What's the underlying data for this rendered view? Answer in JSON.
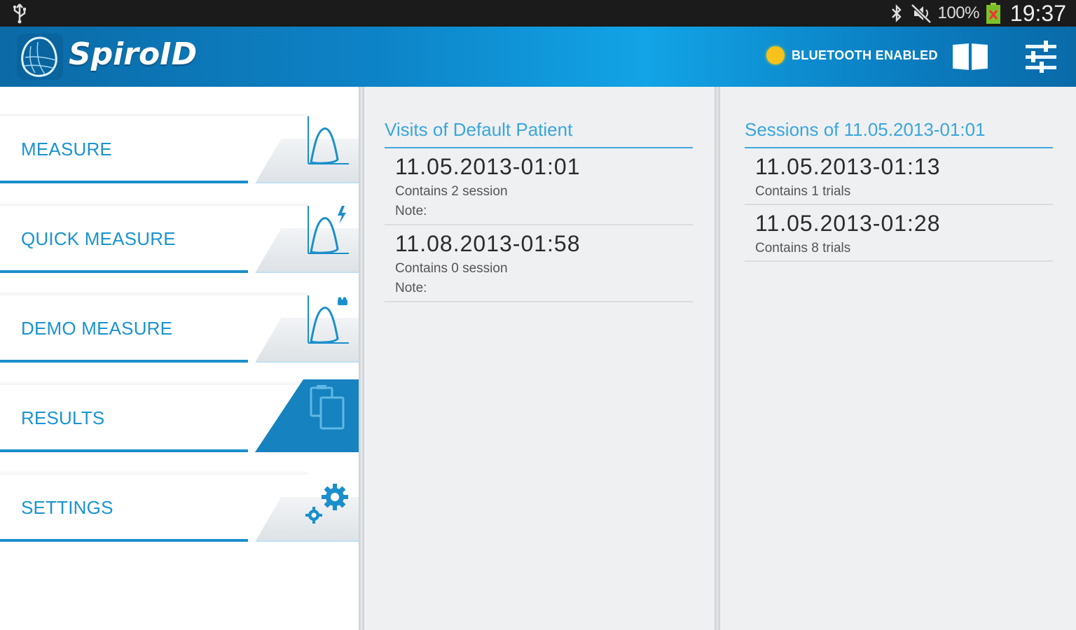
{
  "status_bar": {
    "battery_percent": "100%",
    "time": "19:37",
    "icons": [
      "usb-icon",
      "bluetooth-icon",
      "mute-icon",
      "battery-icon"
    ]
  },
  "app_bar": {
    "app_name": "SpiroID",
    "bluetooth_status": "BLUETOOTH ENABLED",
    "status_color": "#f7c21b",
    "accent_color": "#1a93d0"
  },
  "sidebar": {
    "items": [
      {
        "label": "MEASURE",
        "icon": "bell-curve-icon",
        "active": false
      },
      {
        "label": "QUICK MEASURE",
        "icon": "bell-curve-lightning-icon",
        "active": false
      },
      {
        "label": "DEMO MEASURE",
        "icon": "bell-curve-demo-icon",
        "active": false
      },
      {
        "label": "RESULTS",
        "icon": "copy-documents-icon",
        "active": true
      },
      {
        "label": "SETTINGS",
        "icon": "gears-icon",
        "active": false
      }
    ]
  },
  "visits_panel": {
    "title": "Visits of Default Patient",
    "items": [
      {
        "title": "11.05.2013-01:01",
        "subtitle": "Contains 2 session",
        "note": "Note:"
      },
      {
        "title": "11.08.2013-01:58",
        "subtitle": "Contains 0 session",
        "note": "Note:"
      }
    ]
  },
  "sessions_panel": {
    "title": "Sessions of 11.05.2013-01:01",
    "items": [
      {
        "title": "11.05.2013-01:13",
        "subtitle": "Contains 1 trials"
      },
      {
        "title": "11.05.2013-01:28",
        "subtitle": "Contains 8 trials"
      }
    ]
  }
}
